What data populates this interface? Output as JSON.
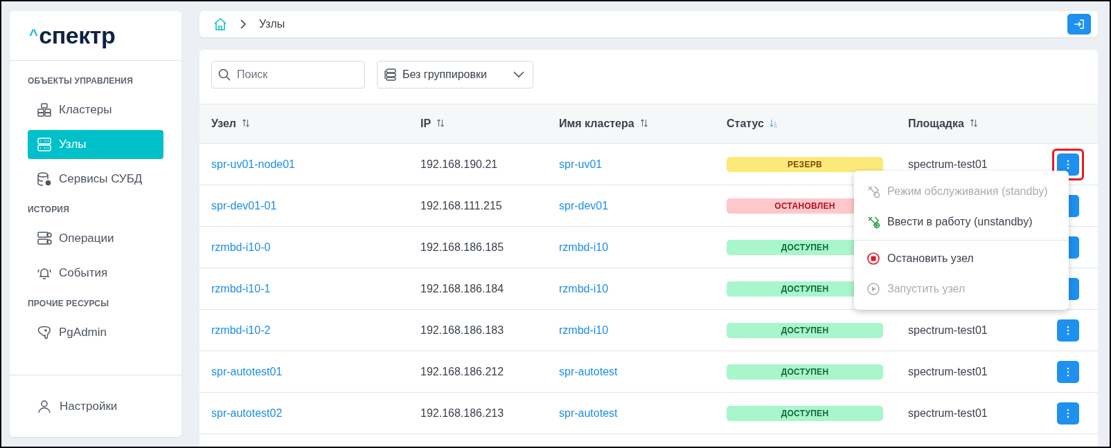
{
  "logo": {
    "mark": "^",
    "text": "спектр"
  },
  "sidebar": {
    "sections": [
      {
        "title": "ОБЪЕКТЫ УПРАВЛЕНИЯ",
        "items": [
          {
            "label": "Кластеры",
            "selected": false
          },
          {
            "label": "Узлы",
            "selected": true
          },
          {
            "label": "Сервисы СУБД",
            "selected": false
          }
        ]
      },
      {
        "title": "ИСТОРИЯ",
        "items": [
          {
            "label": "Операции",
            "selected": false
          },
          {
            "label": "События",
            "selected": false
          }
        ]
      },
      {
        "title": "ПРОЧИЕ РЕСУРСЫ",
        "items": [
          {
            "label": "PgAdmin",
            "selected": false
          }
        ]
      }
    ],
    "footer": {
      "label": "Настройки"
    }
  },
  "breadcrumb": {
    "current": "Узлы"
  },
  "toolbar": {
    "search": {
      "placeholder": "Поиск"
    },
    "grouping": {
      "value": "Без группировки"
    }
  },
  "table": {
    "columns": [
      {
        "label": "Узел",
        "sorted": false
      },
      {
        "label": "IP",
        "sorted": false
      },
      {
        "label": "Имя кластера",
        "sorted": false
      },
      {
        "label": "Статус",
        "sorted": true
      },
      {
        "label": "Площадка",
        "sorted": false
      }
    ],
    "rows": [
      {
        "node": "spr-uv01-node01",
        "ip": "192.168.190.21",
        "cluster": "spr-uv01",
        "status": {
          "label": "РЕЗЕРВ",
          "kind": "reserve"
        },
        "site": "spectrum-test01",
        "highlighted": true
      },
      {
        "node": "spr-dev01-01",
        "ip": "192.168.111.215",
        "cluster": "spr-dev01",
        "status": {
          "label": "ОСТАНОВЛЕН",
          "kind": "stopped"
        },
        "highlighted": false
      },
      {
        "node": "rzmbd-i10-0",
        "ip": "192.168.186.185",
        "cluster": "rzmbd-i10",
        "status": {
          "label": "ДОСТУПЕН",
          "kind": "available"
        },
        "highlighted": false
      },
      {
        "node": "rzmbd-i10-1",
        "ip": "192.168.186.184",
        "cluster": "rzmbd-i10",
        "status": {
          "label": "ДОСТУПЕН",
          "kind": "available"
        },
        "highlighted": false
      },
      {
        "node": "rzmbd-i10-2",
        "ip": "192.168.186.183",
        "cluster": "rzmbd-i10",
        "status": {
          "label": "ДОСТУПЕН",
          "kind": "available"
        },
        "site": "spectrum-test01",
        "highlighted": false
      },
      {
        "node": "spr-autotest01",
        "ip": "192.168.186.212",
        "cluster": "spr-autotest",
        "status": {
          "label": "ДОСТУПЕН",
          "kind": "available"
        },
        "site": "spectrum-test01",
        "highlighted": false
      },
      {
        "node": "spr-autotest02",
        "ip": "192.168.186.213",
        "cluster": "spr-autotest",
        "status": {
          "label": "ДОСТУПЕН",
          "kind": "available"
        },
        "site": "spectrum-test01",
        "highlighted": false
      }
    ]
  },
  "menu": {
    "groups": [
      [
        {
          "label": "Режим обслуживания (standby)",
          "disabled": true
        },
        {
          "label": "Ввести в работу (unstandby)",
          "disabled": false
        }
      ],
      [
        {
          "label": "Остановить узел",
          "disabled": false
        },
        {
          "label": "Запустить узел",
          "disabled": true
        }
      ]
    ]
  }
}
